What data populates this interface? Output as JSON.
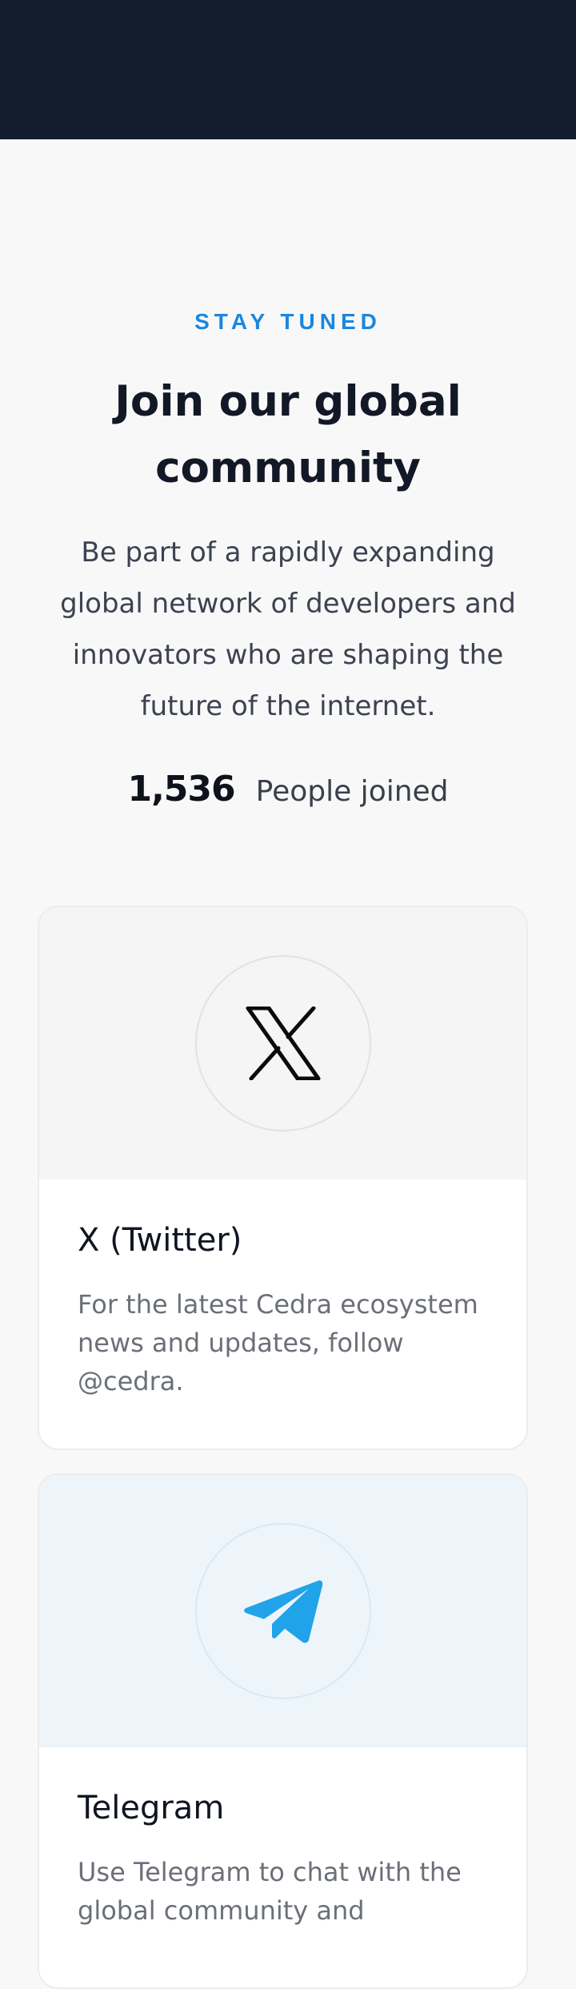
{
  "header": {
    "background": "#141d2d"
  },
  "hero": {
    "eyebrow": "STAY TUNED",
    "title": "Join our global community",
    "subtitle": "Be part of a rapidly expanding global network of developers and innovators who are shaping the future of the internet.",
    "joined_count": "1,536",
    "joined_label": "People joined",
    "accent_color": "#1a86e0"
  },
  "cards": [
    {
      "icon": "x-logo-icon",
      "title": "X (Twitter)",
      "description": "For the latest Cedra ecosystem news and updates, follow @cedra."
    },
    {
      "icon": "telegram-plane-icon",
      "title": "Telegram",
      "description": "Use Telegram to chat with the global community and"
    }
  ]
}
